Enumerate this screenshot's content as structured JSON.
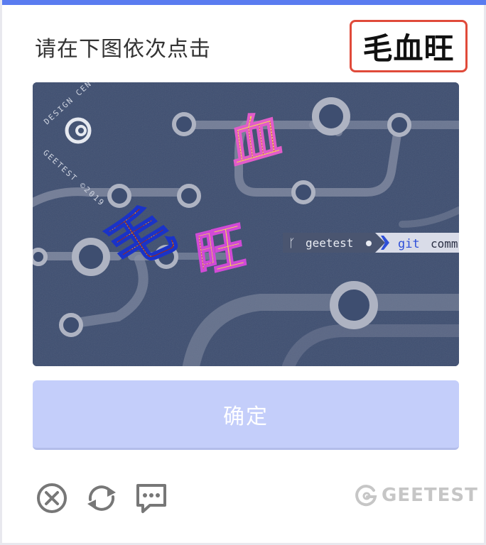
{
  "instruction": "请在下图依次点击",
  "target_chars": "毛血旺",
  "captcha": {
    "badge": {
      "top_text": "DESIGN CENTER",
      "bottom_text": "GEETEST ©2019"
    },
    "terminal": {
      "prompt": "geetest",
      "command": "git",
      "command_rest": "comm"
    },
    "chars": [
      "血",
      "旺",
      "毛"
    ]
  },
  "confirm_label": "确定",
  "footer": {
    "close_icon": "close-circle-icon",
    "refresh_icon": "refresh-icon",
    "feedback_icon": "feedback-icon",
    "brand_name": "GEETEST"
  },
  "colors": {
    "accent_bar": "#5a7cf0",
    "target_border": "#e04a3a",
    "captcha_bg": "#3e4e70",
    "confirm_bg": "#c4cefa",
    "char_fill_yellow": "#f2e34a",
    "char_fill_red": "#a52a1a"
  }
}
